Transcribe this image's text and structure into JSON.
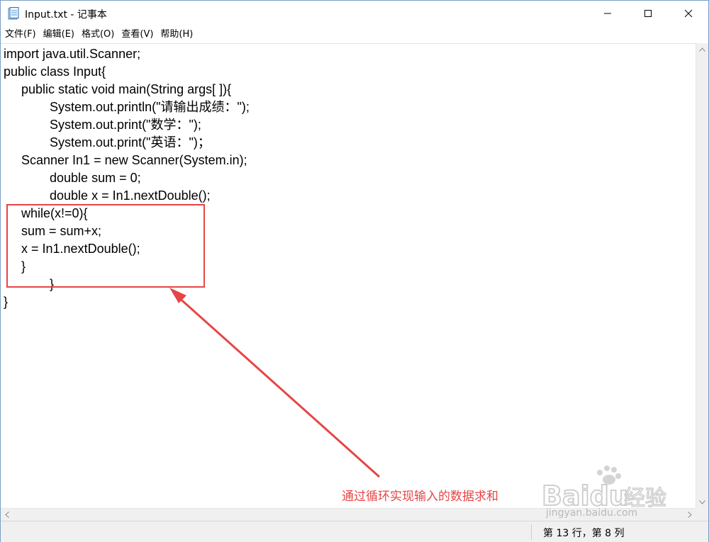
{
  "window": {
    "title": "Input.txt - 记事本",
    "min_label": "—",
    "max_label": "☐",
    "close_label": "✕"
  },
  "menu": [
    {
      "label": "文件(F)"
    },
    {
      "label": "编辑(E)"
    },
    {
      "label": "格式(O)"
    },
    {
      "label": "查看(V)"
    },
    {
      "label": "帮助(H)"
    }
  ],
  "code_lines": [
    "import java.util.Scanner;",
    "public class Input{",
    "     public static void main(String args[ ]){",
    "             System.out.println(\"请输出成绩：\");",
    "             System.out.print(\"数学：\");",
    "             System.out.print(\"英语：\")；",
    "     Scanner In1 = new Scanner(System.in);",
    "             double sum = 0;",
    "             double x = In1.nextDouble();",
    "     while(x!=0){",
    "     sum = sum+x;",
    "     x = In1.nextDouble();",
    "     }",
    "             }",
    "}"
  ],
  "status": {
    "position": "第 13 行，第 8 列"
  },
  "annotation": {
    "text": "通过循环实现输入的数据求和",
    "color": "#e64545"
  },
  "watermark": {
    "brand": "Baidu经验",
    "url": "jingyan.baidu.com"
  }
}
